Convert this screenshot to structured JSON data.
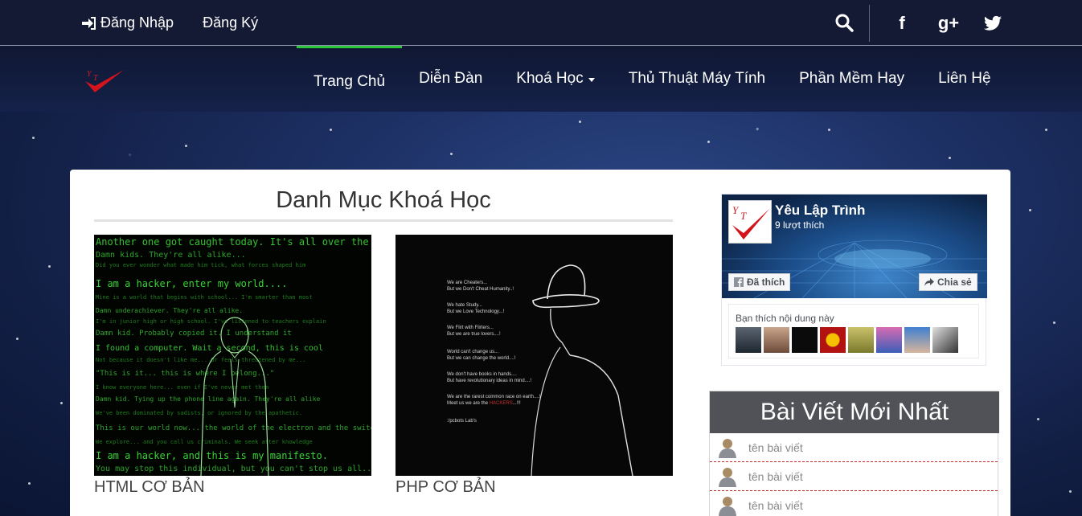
{
  "topbar": {
    "login_label": "Đăng Nhập",
    "register_label": "Đăng Ký",
    "login_icon": "sign-in-icon",
    "search_icon": "search-icon",
    "social": [
      {
        "icon": "facebook-icon",
        "glyph": "f"
      },
      {
        "icon": "google-plus-icon",
        "glyph": "g+"
      },
      {
        "icon": "twitter-icon",
        "glyph": "t"
      }
    ]
  },
  "nav": {
    "items": [
      {
        "label": "Trang Chủ",
        "active": true
      },
      {
        "label": "Diễn Đàn"
      },
      {
        "label": "Khoá Học",
        "dropdown": true
      },
      {
        "label": "Thủ Thuật Máy Tính"
      },
      {
        "label": "Phần Mềm Hay"
      },
      {
        "label": "Liên Hệ"
      }
    ],
    "accent_color": "#2cc63a"
  },
  "main": {
    "section_title": "Danh Mục Khoá Học",
    "courses": [
      {
        "caption": "HTML CƠ BẢN"
      },
      {
        "caption": "PHP CƠ BẢN"
      }
    ]
  },
  "facebook": {
    "page_name": "Yêu Lập Trình",
    "likes": "9 lượt thích",
    "like_button": "Đã thích",
    "share_button": "Chia sẻ",
    "friends_label": "Bạn thích nội dung này"
  },
  "recent": {
    "title": "Bài Viết Mới Nhất",
    "posts": [
      "tên bài viết",
      "tên bài viết",
      "tên bài viết"
    ]
  }
}
